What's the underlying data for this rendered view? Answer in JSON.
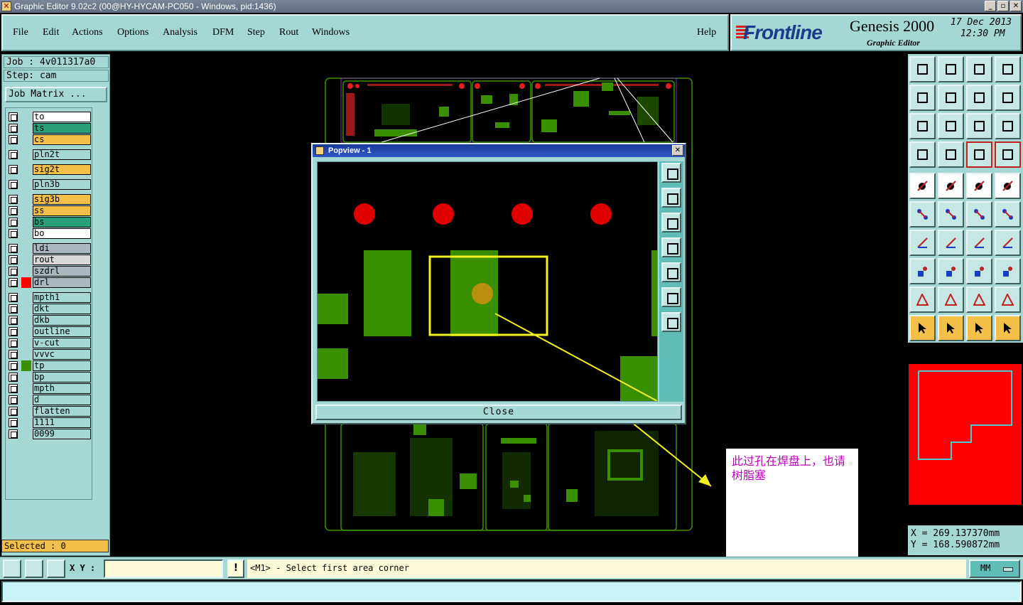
{
  "window": {
    "title": "Graphic Editor 9.02c2 (00@HY-HYCAM-PC050 - Windows, pid:1436)",
    "controls": [
      "_",
      "▫",
      "✕"
    ]
  },
  "menu": {
    "items": [
      "File",
      "Edit",
      "Actions",
      "Options",
      "Analysis",
      "DFM",
      "Step",
      "Rout",
      "Windows"
    ],
    "help": "Help"
  },
  "brand": {
    "logo": "Frontline",
    "product": "Genesis 2000",
    "subtitle": "Graphic Editor",
    "date": "17 Dec 2013",
    "time": "12:30 PM"
  },
  "job": {
    "job_line": "Job : 4v011317a0",
    "step_line": "Step: cam",
    "matrix_button": "Job Matrix ..."
  },
  "layers": [
    {
      "name": "to",
      "bg": "#ffffff",
      "color": ""
    },
    {
      "name": "ts",
      "bg": "#2aa07a",
      "color": ""
    },
    {
      "name": "cs",
      "bg": "#f5c04a",
      "color": ""
    },
    {
      "name": "pln2t",
      "bg": "#a5d7d4",
      "color": ""
    },
    {
      "name": "sig2t",
      "bg": "#f5c04a",
      "color": ""
    },
    {
      "name": "pln3b",
      "bg": "#a5d7d4",
      "color": ""
    },
    {
      "name": "sig3b",
      "bg": "#f5c04a",
      "color": ""
    },
    {
      "name": "ss",
      "bg": "#f5c04a",
      "color": ""
    },
    {
      "name": "bs",
      "bg": "#2aa07a",
      "color": ""
    },
    {
      "name": "bo",
      "bg": "#ffffff",
      "color": ""
    },
    {
      "name": "ldi",
      "bg": "#a8b8c0",
      "color": ""
    },
    {
      "name": "rout",
      "bg": "#d8d8d8",
      "color": ""
    },
    {
      "name": "szdrl",
      "bg": "#a8b8c0",
      "color": ""
    },
    {
      "name": "drl",
      "bg": "#a8b8c0",
      "color": "#ff0000"
    },
    {
      "name": "mpth1",
      "bg": "#a5d7d4",
      "color": ""
    },
    {
      "name": "dkt",
      "bg": "#a5d7d4",
      "color": ""
    },
    {
      "name": "dkb",
      "bg": "#a5d7d4",
      "color": ""
    },
    {
      "name": "outline",
      "bg": "#a5d7d4",
      "color": ""
    },
    {
      "name": "v-cut",
      "bg": "#a5d7d4",
      "color": ""
    },
    {
      "name": "vvvc",
      "bg": "#a5d7d4",
      "color": ""
    },
    {
      "name": "tp",
      "bg": "#a5d7d4",
      "color": "#3a8f00"
    },
    {
      "name": "bp",
      "bg": "#a5d7d4",
      "color": ""
    },
    {
      "name": "mpth",
      "bg": "#a5d7d4",
      "color": ""
    },
    {
      "name": "d",
      "bg": "#a5d7d4",
      "color": ""
    },
    {
      "name": "flatten",
      "bg": "#a5d7d4",
      "color": ""
    },
    {
      "name": "1111",
      "bg": "#a5d7d4",
      "color": ""
    },
    {
      "name": "0099",
      "bg": "#a5d7d4",
      "color": ""
    }
  ],
  "selected": "Selected : 0",
  "popview": {
    "title": "Popview - 1",
    "close_label": "Close"
  },
  "note": "此过孔在焊盘上，也请树脂塞",
  "coords": {
    "x": "X  =  269.137370mm",
    "y": "Y  =  168.590872mm"
  },
  "status": {
    "xy_label": "X Y :",
    "xy_value": "",
    "excl": "!",
    "message": "<M1> - Select first area corner",
    "units": "MM"
  },
  "toolbox": {
    "grid_icons": [
      "open-job-icon",
      "save-icon",
      "home-icon",
      "window-icon",
      "zoom-in-icon",
      "zoom-out-icon",
      "pan-icon",
      "redraw-icon",
      "zoom-fit-icon",
      "zoom-center-icon",
      "scale-1-2-icon",
      "help-icon",
      "tools-icon",
      "grid-icon",
      "layers-display-icon",
      "layers-features-icon",
      "select-feature-icon",
      "measure-icon",
      "ruler-icon",
      "snap-icon",
      "connect-icon",
      "intersect-icon",
      "line-add-icon",
      "pad-add-icon",
      "angle-icon",
      "slope-icon",
      "arc-icon",
      "text-icon",
      "pad-move-icon",
      "line-split-icon",
      "resize-icon",
      "group-icon",
      "triangle-a-icon",
      "triangle-b-icon",
      "triangle-c-icon",
      "triangle-d-icon",
      "pointer-icon",
      "pointer-box-icon",
      "pointer-select-icon",
      "route-icon"
    ]
  }
}
